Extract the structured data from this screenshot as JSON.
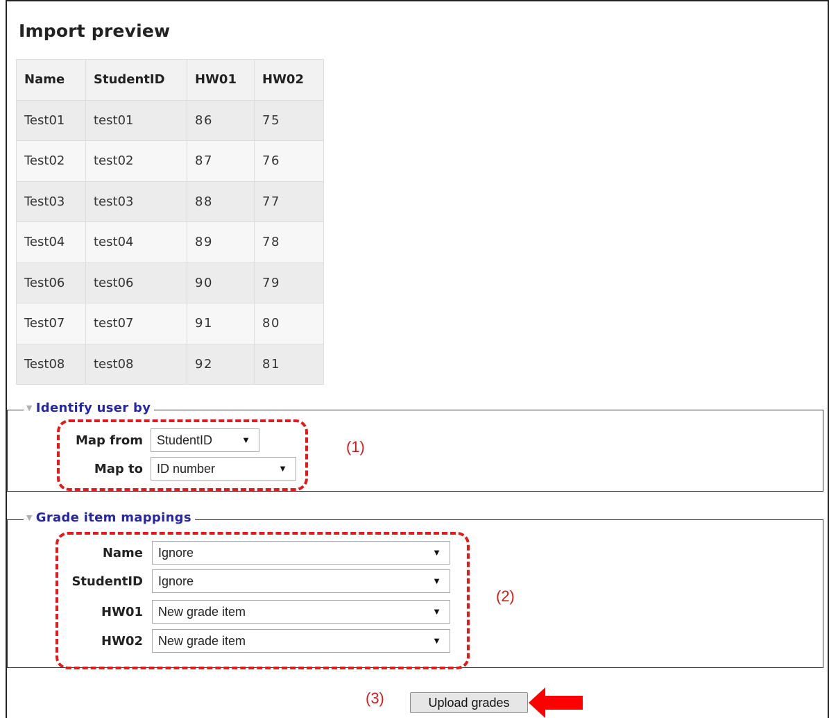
{
  "page": {
    "title": "Import preview"
  },
  "preview_table": {
    "headers": [
      "Name",
      "StudentID",
      "HW01",
      "HW02"
    ],
    "rows": [
      [
        "Test01",
        "test01",
        "86",
        "75"
      ],
      [
        "Test02",
        "test02",
        "87",
        "76"
      ],
      [
        "Test03",
        "test03",
        "88",
        "77"
      ],
      [
        "Test04",
        "test04",
        "89",
        "78"
      ],
      [
        "Test06",
        "test06",
        "90",
        "79"
      ],
      [
        "Test07",
        "test07",
        "91",
        "80"
      ],
      [
        "Test08",
        "test08",
        "92",
        "81"
      ]
    ]
  },
  "identify_user": {
    "legend": "Identify user by",
    "map_from": {
      "label": "Map from",
      "value": "StudentID"
    },
    "map_to": {
      "label": "Map to",
      "value": "ID number"
    }
  },
  "grade_mappings": {
    "legend": "Grade item mappings",
    "items": [
      {
        "label": "Name",
        "value": "Ignore"
      },
      {
        "label": "StudentID",
        "value": "Ignore"
      },
      {
        "label": "HW01",
        "value": "New grade item"
      },
      {
        "label": "HW02",
        "value": "New grade item"
      }
    ]
  },
  "annotations": {
    "step1": "(1)",
    "step2": "(2)",
    "step3": "(3)"
  },
  "actions": {
    "upload_label": "Upload grades"
  },
  "colors": {
    "legend": "#2525a8",
    "annotation": "#e31a1a"
  },
  "icons": {
    "dropdown": "triangle-down-icon",
    "collapse": "triangle-down-icon",
    "pointer": "arrow-left-icon"
  }
}
